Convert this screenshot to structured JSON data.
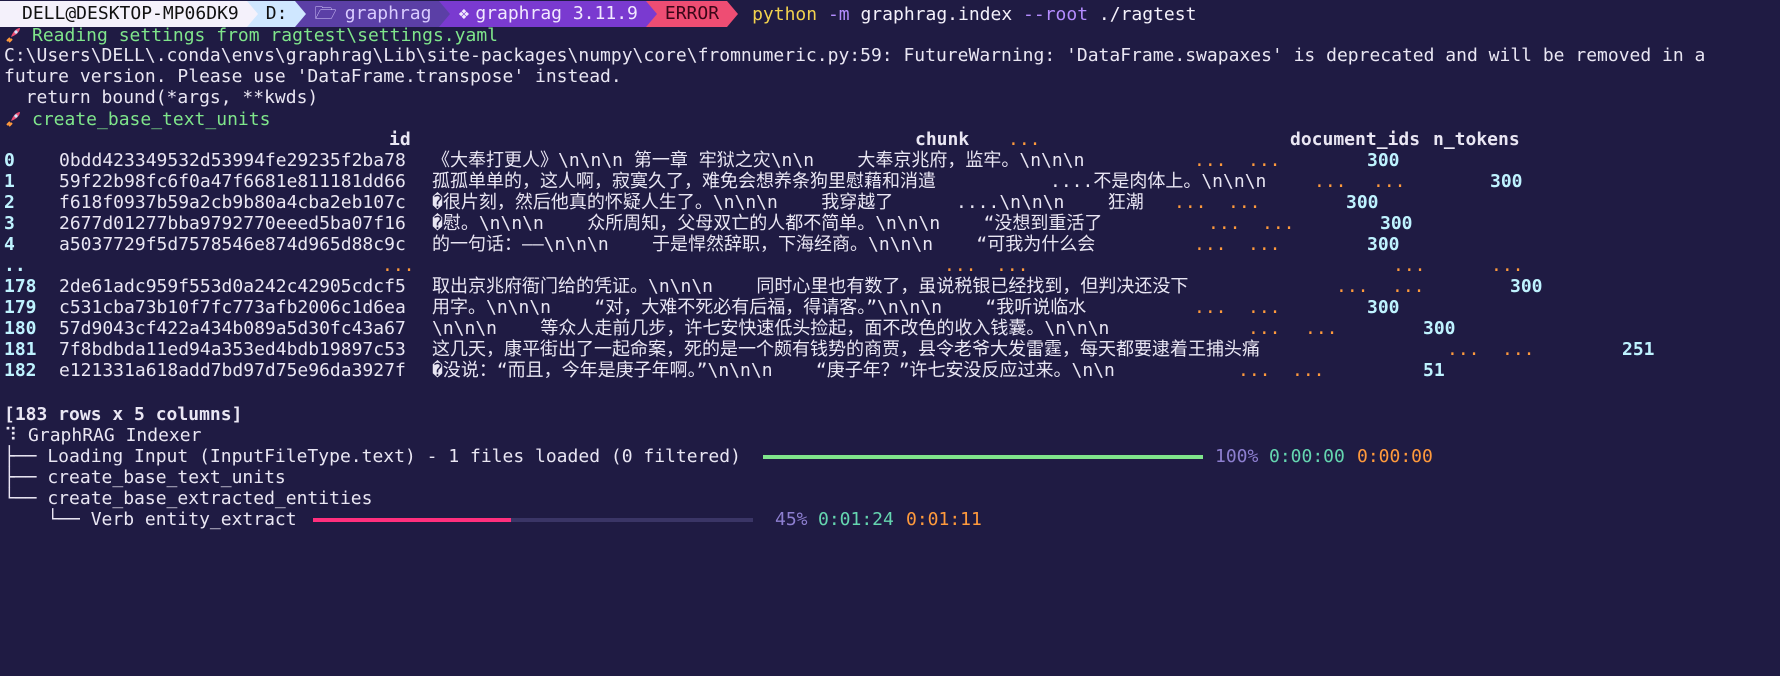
{
  "prompt": {
    "user": "DELL@DESKTOP-MP06DK9",
    "drive": "D:",
    "folder": "graphrag",
    "env": "graphrag 3.11.9",
    "status": "ERROR",
    "cmd_python": "python",
    "cmd_flag_m": "-m",
    "cmd_module": "graphrag.index",
    "cmd_flag_root": "--root",
    "cmd_path": "./ragtest"
  },
  "log": {
    "reading": "Reading settings from ragtest\\settings.yaml",
    "warning_line1": "C:\\Users\\DELL\\.conda\\envs\\graphrag\\Lib\\site-packages\\numpy\\core\\fromnumeric.py:59: FutureWarning: 'DataFrame.swapaxes' is deprecated and will be removed in a",
    "warning_line2": "future version. Please use 'DataFrame.transpose' instead.",
    "warning_line3": "  return bound(*args, **kwds)",
    "step": "create_base_text_units"
  },
  "table": {
    "headers": {
      "id": "id",
      "chunk": "chunk",
      "ellipsis": "...",
      "document_ids": "document_ids",
      "n_tokens": "n_tokens"
    },
    "rows": [
      {
        "idx": "0",
        "id": "0bdd423349532d53994fe29235f2ba78",
        "chunk": "《大奉打更人》\\n\\n\\n 第一章 牢狱之灾\\n\\n    大奉京兆府，监牢。\\n\\n\\n",
        "e1": "...",
        "e2": "...",
        "ntok": "300"
      },
      {
        "idx": "1",
        "id": "59f22b98fc6f0a47f6681e811181dd66",
        "chunk": "孤孤单单的，这人啊，寂寞久了，难免会想养条狗里慰藉和消遣",
        "c2": "....不是肉体上。\\n\\n\\n",
        "e1": "...",
        "e2": "...",
        "ntok": "300"
      },
      {
        "idx": "2",
        "id": "f618f0937b59a2cb9b80a4cba2eb107c",
        "chunk": "�很片刻，然后他真的怀疑人生了。\\n\\n\\n    我穿越了",
        "c2": "....\\n\\n\\n    狂潮",
        "e1": "...",
        "e2": "...",
        "ntok": "300"
      },
      {
        "idx": "3",
        "id": "2677d01277bba9792770eeed5ba07f16",
        "chunk": "�慰。\\n\\n\\n    众所周知，父母双亡的人都不简单。\\n\\n\\n    “没想到重活了",
        "e1": "...",
        "e2": "...",
        "ntok": "300"
      },
      {
        "idx": "4",
        "id": "a5037729f5d7578546e874d965d88c9c",
        "chunk": "的一句话：——\\n\\n\\n    于是悍然辞职，下海经商。\\n\\n\\n    “可我为什么会",
        "e1": "...",
        "e2": "...",
        "ntok": "300"
      },
      {
        "idx": "..",
        "id": "...",
        "chunk": "",
        "e1": "...",
        "e2": "...",
        "e3": "...",
        "e4": "...",
        "ntok": ""
      },
      {
        "idx": "178",
        "id": "2de61adc959f553d0a242c42905cdcf5",
        "chunk": "取出京兆府衙门给的凭证。\\n\\n\\n    同时心里也有数了，虽说税银已经找到，但判决还没下",
        "e1": "...",
        "e2": "...",
        "ntok": "300"
      },
      {
        "idx": "179",
        "id": "c531cba73b10f7fc773afb2006c1d6ea",
        "chunk": "用字。\\n\\n\\n    “对，大难不死必有后福，得请客。”\\n\\n\\n    “我听说临水",
        "e1": "...",
        "e2": "...",
        "ntok": "300"
      },
      {
        "idx": "180",
        "id": "57d9043cf422a434b089a5d30fc43a67",
        "chunk": "\\n\\n\\n    等众人走前几步，许七安快速低头捡起，面不改色的收入钱囊。\\n\\n\\n",
        "e1": "...",
        "e2": "...",
        "ntok": "300"
      },
      {
        "idx": "181",
        "id": "7f8bdbda11ed94a353ed4bdb19897c53",
        "chunk": "这几天，康平街出了一起命案，死的是一个颇有钱势的商贾，县令老爷大发雷霆，每天都要逮着王捕头痛",
        "e1": "...",
        "e2": "...",
        "ntok": "251"
      },
      {
        "idx": "182",
        "id": "e121331a618add7bd97d75e96da3927f",
        "chunk": "�没说：“而且，今年是庚子年啊。”\\n\\n\\n    “庚子年？”许七安没反应过来。\\n\\n",
        "e1": "...",
        "e2": "...",
        "ntok": "51"
      }
    ],
    "summary": "[183 rows x 5 columns]"
  },
  "indexer": {
    "title": "GraphRAG Indexer",
    "tree1": "├── Loading Input (InputFileType.text) - 1 files loaded (0 filtered)",
    "tree1_pct": "100%",
    "tree1_elapsed": "0:00:00",
    "tree1_remaining": "0:00:00",
    "tree1_progress": 1.0,
    "tree2": "├── create_base_text_units",
    "tree3": "└── create_base_extracted_entities",
    "tree4": "    └── Verb entity_extract",
    "tree4_pct": "45%",
    "tree4_elapsed": "0:01:24",
    "tree4_remaining": "0:01:11",
    "tree4_progress": 0.45
  },
  "colors": {
    "background": "#1f1b43",
    "error": "#ee4d73",
    "progress_done": "#7fe58b",
    "progress_active": "#ff2f7d"
  }
}
